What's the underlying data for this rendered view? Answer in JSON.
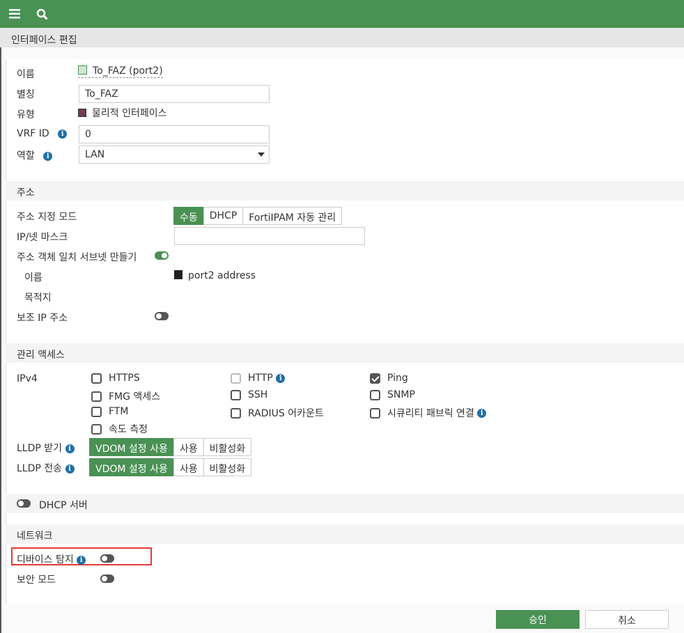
{
  "header": {
    "title": "인터페이스 편집"
  },
  "colors": {
    "accent": "#4a9154",
    "info": "#1f6fa8",
    "highlight": "#e53935"
  },
  "general": {
    "name_label": "이름",
    "name_value": "To_FAZ (port2)",
    "alias_label": "별칭",
    "alias_value": "To_FAZ",
    "type_label": "유형",
    "type_value": "물리적 인터페이스",
    "vrf_label": "VRF ID",
    "vrf_value": "0",
    "role_label": "역할",
    "role_value": "LAN"
  },
  "address": {
    "section": "주소",
    "mode_label": "주소 지정 모드",
    "modes": [
      "수동",
      "DHCP",
      "FortiIPAM 자동 관리"
    ],
    "mode_selected": "수동",
    "ip_label": "IP/넷 마스크",
    "ip_value": "",
    "create_subnet_label": "주소 객체 일치 서브넷 만들기",
    "create_subnet_on": true,
    "obj_name_label": "이름",
    "obj_name_value": "port2 address",
    "dest_label": "목적지",
    "secondary_label": "보조 IP 주소",
    "secondary_on": false
  },
  "admin": {
    "section": "관리 액세스",
    "ipv4_label": "IPv4",
    "options": [
      {
        "label": "HTTPS",
        "checked": false
      },
      {
        "label": "HTTP",
        "checked": false,
        "disabled": true
      },
      {
        "label": "Ping",
        "checked": true
      },
      {
        "label": "FMG 액세스",
        "checked": false
      },
      {
        "label": "SSH",
        "checked": false
      },
      {
        "label": "SNMP",
        "checked": false
      },
      {
        "label": "FTM",
        "checked": false
      },
      {
        "label": "RADIUS 어카운트",
        "checked": false
      },
      {
        "label": "시큐리티 패브릭 연결",
        "checked": false
      },
      {
        "label": "속도 측정",
        "checked": false
      }
    ],
    "lldp_rx_label": "LLDP 받기",
    "lldp_tx_label": "LLDP 전송",
    "lldp_opts": [
      "VDOM 설정 사용",
      "사용",
      "비활성화"
    ],
    "lldp_selected": "VDOM 설정 사용"
  },
  "dhcp": {
    "label": "DHCP 서버",
    "on": false
  },
  "network": {
    "section": "네트워크",
    "device_detect_label": "디바이스 탐지",
    "device_detect_on": false,
    "security_mode_label": "보안 모드",
    "security_mode_on": false
  },
  "footer": {
    "ok": "승인",
    "cancel": "취소"
  }
}
